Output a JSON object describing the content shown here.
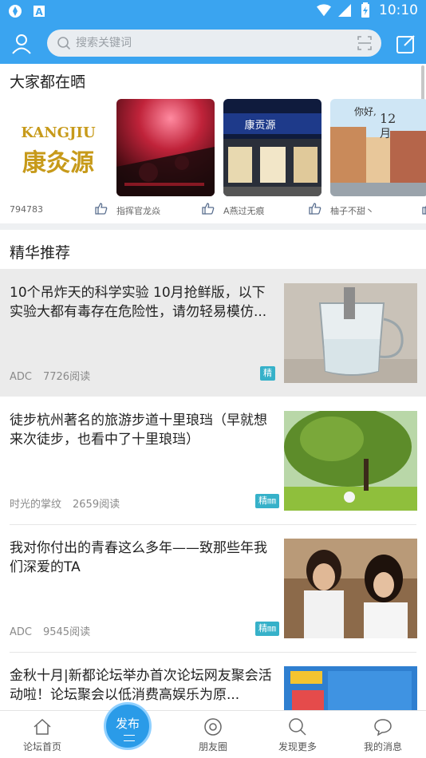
{
  "status_bar": {
    "time": "10:10",
    "left_icons": [
      "app-icon",
      "notification-a-icon"
    ],
    "right_icons": [
      "wifi-icon",
      "signal-icon",
      "battery-icon"
    ]
  },
  "header": {
    "search_placeholder": "搜索关键词",
    "user_icon": "user-icon",
    "scan_icon": "scan-icon",
    "edit_icon": "edit-icon"
  },
  "share_section": {
    "title": "大家都在晒",
    "items": [
      {
        "name": "794783"
      },
      {
        "name": "指挥官龙焱"
      },
      {
        "name": "A燕过无痕"
      },
      {
        "name": "柚子不甜丶"
      }
    ]
  },
  "featured_section": {
    "title": "精华推荐",
    "articles": [
      {
        "title": "10个吊炸天的科学实验 10月抢鲜版，以下实验大都有毒存在危险性，请勿轻易模仿...",
        "author": "ADC",
        "reads": "7726阅读",
        "badge": "精"
      },
      {
        "title": "徒步杭州著名的旅游步道十里琅珰（早就想来次徒步，也看中了十里琅珰）",
        "author": "时光的掌纹",
        "reads": "2659阅读",
        "badge": "精㎜"
      },
      {
        "title": "我对你付出的青春这么多年——致那些年我们深爱的TA",
        "author": "ADC",
        "reads": "9545阅读",
        "badge": "精㎜"
      },
      {
        "title": "金秋十月|新都论坛举办首次论坛网友聚会活动啦！论坛聚会以低消费高娱乐为原...",
        "author": "",
        "reads": "",
        "badge": ""
      }
    ]
  },
  "tabbar": {
    "home": "论坛首页",
    "publish": "发布",
    "friends": "朋友圈",
    "discover": "发现更多",
    "messages": "我的消息"
  },
  "colors": {
    "primary": "#3aa4f0",
    "badge": "#36b1c9",
    "fab": "#2a9be8"
  }
}
